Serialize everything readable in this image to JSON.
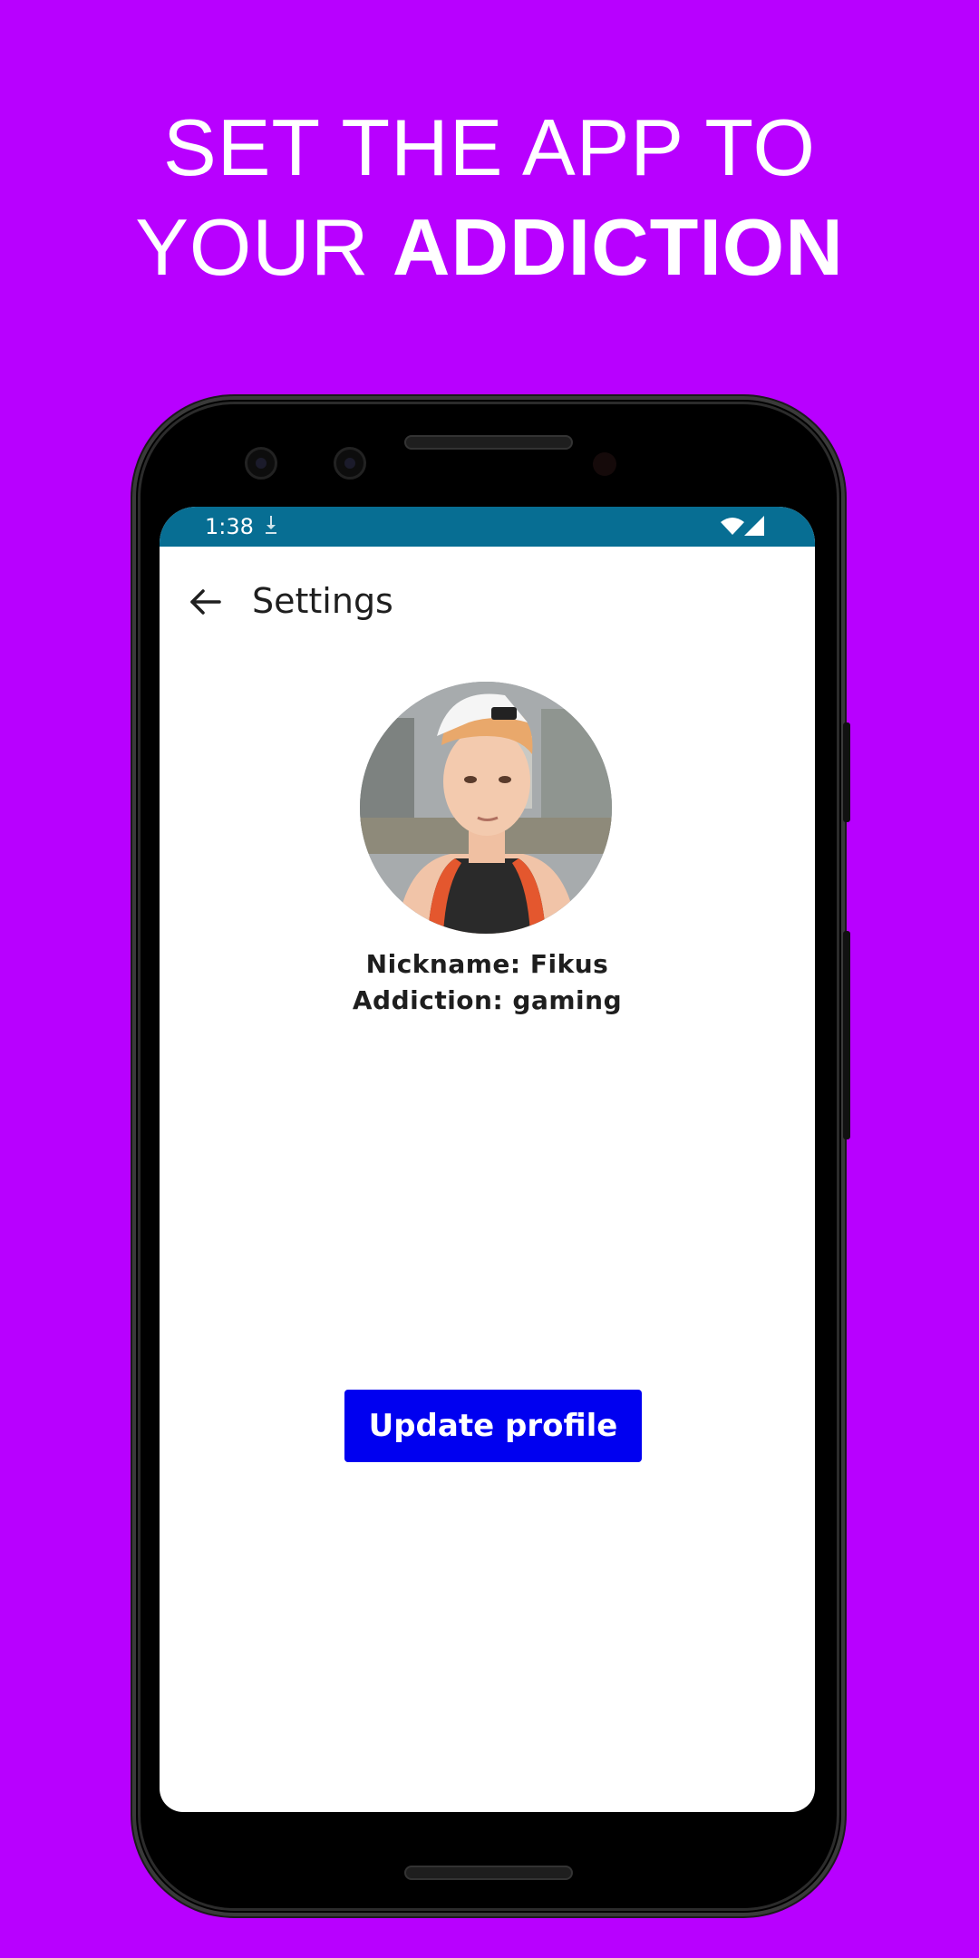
{
  "promo": {
    "line1": "SET THE APP TO",
    "line2_regular": "YOUR",
    "line2_bold": "ADDICTION"
  },
  "status_bar": {
    "time": "1:38",
    "icons": [
      "download-icon",
      "wifi-icon",
      "cellular-signal-icon"
    ]
  },
  "app_bar": {
    "title": "Settings",
    "back_icon": "arrow-back-icon"
  },
  "profile": {
    "nickname_line": "Nickname: Fikus",
    "addiction_line": "Addiction: gaming"
  },
  "actions": {
    "update_label": "Update profile"
  },
  "colors": {
    "background": "#b800ff",
    "status_bar": "#076e93",
    "button": "#0000f0",
    "screen": "#ffffff"
  }
}
